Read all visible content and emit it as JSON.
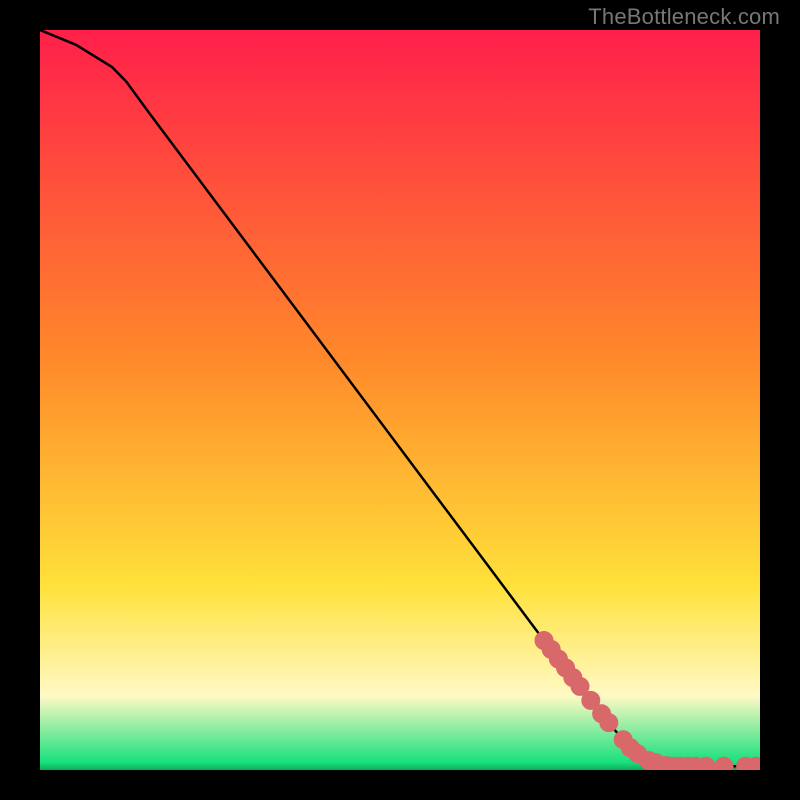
{
  "attribution": "TheBottleneck.com",
  "colors": {
    "gradient_top": "#ff1f4a",
    "gradient_mid": "#ffe13a",
    "gradient_green": "#17e07e",
    "curve": "#000000",
    "marker_fill": "#d8686a",
    "marker_stroke": "#d8686a"
  },
  "chart_data": {
    "type": "line",
    "title": "",
    "xlabel": "",
    "ylabel": "",
    "x": [
      0,
      5,
      10,
      12,
      15,
      20,
      25,
      30,
      35,
      40,
      45,
      50,
      55,
      60,
      65,
      70,
      72,
      75,
      80,
      82,
      85,
      88,
      90,
      92,
      94,
      96,
      98,
      100
    ],
    "values": [
      100,
      98,
      95,
      93,
      89,
      82.5,
      76,
      69.5,
      63,
      56.5,
      50,
      43.5,
      37,
      30.5,
      24,
      17.5,
      15,
      11.3,
      5.2,
      3,
      1.2,
      0.5,
      0.5,
      0.5,
      0.5,
      0.5,
      0.5,
      0.5
    ],
    "xlim": [
      0,
      100
    ],
    "ylim": [
      0,
      100
    ],
    "markers_x": [
      70,
      71,
      72,
      73,
      74,
      75,
      76.5,
      78,
      79,
      81,
      82,
      83,
      84.5,
      85.5,
      87,
      88,
      89,
      90,
      91,
      92.5,
      95,
      98,
      99.5
    ],
    "markers_y": [
      17.5,
      16.3,
      15,
      13.8,
      12.5,
      11.3,
      9.4,
      7.6,
      6.4,
      4.1,
      3,
      2.2,
      1.3,
      1,
      0.6,
      0.5,
      0.5,
      0.5,
      0.5,
      0.5,
      0.5,
      0.5,
      0.5
    ]
  }
}
